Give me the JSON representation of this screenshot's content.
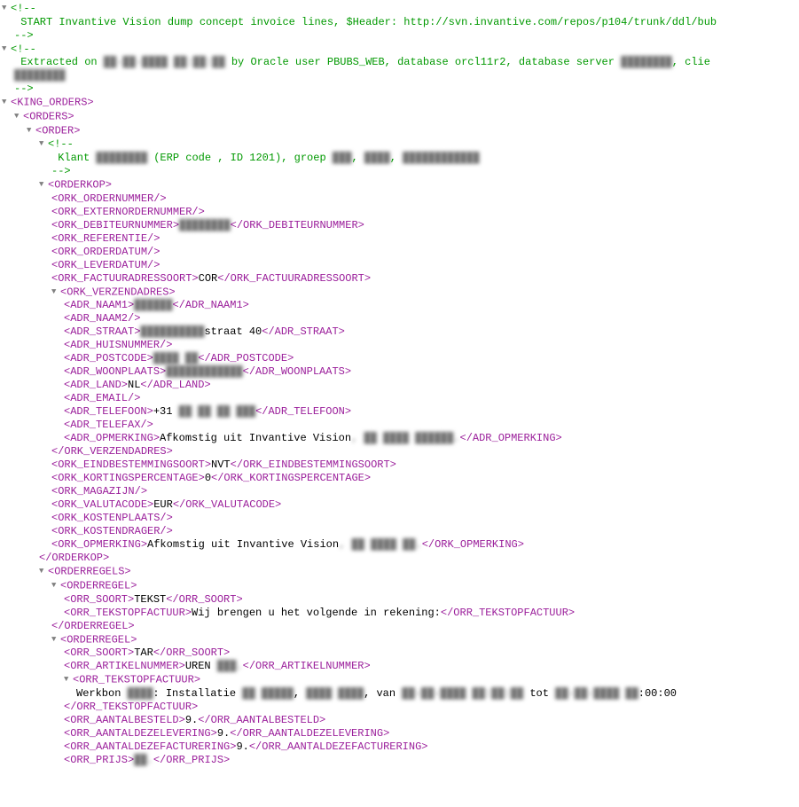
{
  "comment1_open": "<!--",
  "comment1_text": " START Invantive Vision dump concept invoice lines, $Header: http://svn.invantive.com/repos/p104/trunk/ddl/bub",
  "comment1_close": "-->",
  "comment2_open": "<!--",
  "comment2_a": " Extracted on ",
  "comment2_date_blur": "██-██-████ ██:██:██",
  "comment2_b": " by Oracle user PBUBS_WEB, database orcl11r2, database server ",
  "comment2_server_blur": "████████",
  "comment2_c": ", clie",
  "comment2_l2_blur": "████████",
  "comment2_close": "-->",
  "king_orders_open": "<KING_ORDERS>",
  "orders_open": "<ORDERS>",
  "order_open": "<ORDER>",
  "klant_open": "<!--",
  "klant_a": " Klant ",
  "klant_blur1": "████████",
  "klant_b": " (ERP code , ID 1201), groep ",
  "klant_blur2": "███",
  "klant_c": ", ",
  "klant_blur3": "████",
  "klant_d": ", ",
  "klant_blur4": "████████████",
  "klant_close": "-->",
  "orderkop_open": "<ORDERKOP>",
  "ork_ordernummer": "<ORK_ORDERNUMMER/>",
  "ork_externordernummer": "<ORK_EXTERNORDERNUMMER/>",
  "ork_debiteurnummer_open": "<ORK_DEBITEURNUMMER>",
  "ork_debiteurnummer_val_blur": "████████",
  "ork_debiteurnummer_close": "</ORK_DEBITEURNUMMER>",
  "ork_referentie": "<ORK_REFERENTIE/>",
  "ork_orderdatum": "<ORK_ORDERDATUM/>",
  "ork_leverdatum": "<ORK_LEVERDATUM/>",
  "ork_factuuradressoort_open": "<ORK_FACTUURADRESSOORT>",
  "ork_factuuradressoort_val": "COR",
  "ork_factuuradressoort_close": "</ORK_FACTUURADRESSOORT>",
  "ork_verzendadres_open": "<ORK_VERZENDADRES>",
  "adr_naam1_open": "<ADR_NAAM1>",
  "adr_naam1_val_blur": "██████",
  "adr_naam1_close": "</ADR_NAAM1>",
  "adr_naam2": "<ADR_NAAM2/>",
  "adr_straat_open": "<ADR_STRAAT>",
  "adr_straat_pre_blur": "██████████",
  "adr_straat_val": "straat 40",
  "adr_straat_close": "</ADR_STRAAT>",
  "adr_huisnummer": "<ADR_HUISNUMMER/>",
  "adr_postcode_open": "<ADR_POSTCODE>",
  "adr_postcode_val_blur": "████ ██",
  "adr_postcode_close": "</ADR_POSTCODE>",
  "adr_woonplaats_open": "<ADR_WOONPLAATS>",
  "adr_woonplaats_val_blur": "████████████",
  "adr_woonplaats_close": "</ADR_WOONPLAATS>",
  "adr_land_open": "<ADR_LAND>",
  "adr_land_val": "NL",
  "adr_land_close": "</ADR_LAND>",
  "adr_email": "<ADR_EMAIL/>",
  "adr_telefoon_open": "<ADR_TELEFOON>",
  "adr_telefoon_val": "+31 ",
  "adr_telefoon_blur": "██ ██ ██ ███",
  "adr_telefoon_close": "</ADR_TELEFOON>",
  "adr_telefax": "<ADR_TELEFAX/>",
  "adr_opmerking_open": "<ADR_OPMERKING>",
  "adr_opmerking_val": "Afkomstig uit Invantive Vision",
  "adr_opmerking_blur": ", ██ ████ ██████.",
  "adr_opmerking_close": "</ADR_OPMERKING>",
  "ork_verzendadres_close": "</ORK_VERZENDADRES>",
  "ork_eindbestemmingsoort_open": "<ORK_EINDBESTEMMINGSOORT>",
  "ork_eindbestemmingsoort_val": "NVT",
  "ork_eindbestemmingsoort_close": "</ORK_EINDBESTEMMINGSOORT>",
  "ork_kortingspercentage_open": "<ORK_KORTINGSPERCENTAGE>",
  "ork_kortingspercentage_val": "0",
  "ork_kortingspercentage_close": "</ORK_KORTINGSPERCENTAGE>",
  "ork_magazijn": "<ORK_MAGAZIJN/>",
  "ork_valutacode_open": "<ORK_VALUTACODE>",
  "ork_valutacode_val": "EUR",
  "ork_valutacode_close": "</ORK_VALUTACODE>",
  "ork_kostenplaats": "<ORK_KOSTENPLAATS/>",
  "ork_kostendrager": "<ORK_KOSTENDRAGER/>",
  "ork_opmerking_open": "<ORK_OPMERKING>",
  "ork_opmerking_val": "Afkomstig uit Invantive Vision",
  "ork_opmerking_blur": ", ██ ████ ██.",
  "ork_opmerking_close": "</ORK_OPMERKING>",
  "orderkop_close": "</ORDERKOP>",
  "orderregels_open": "<ORDERREGELS>",
  "orderregel_open": "<ORDERREGEL>",
  "orr_soort_open": "<ORR_SOORT>",
  "orr_soort_val1": "TEKST",
  "orr_soort_close": "</ORR_SOORT>",
  "orr_tekstopfactuur_open": "<ORR_TEKSTOPFACTUUR>",
  "orr_tekstopfactuur_val1": "Wij brengen u het volgende in rekening:",
  "orr_tekstopfactuur_close": "</ORR_TEKSTOPFACTUUR>",
  "orderregel_close": "</ORDERREGEL>",
  "orr_soort_val2": "TAR",
  "orr_artikelnummer_open": "<ORR_ARTIKELNUMMER>",
  "orr_artikelnummer_val": "UREN ",
  "orr_artikelnummer_blur": "███.",
  "orr_artikelnummer_close": "</ORR_ARTIKELNUMMER>",
  "werkbon_a": "Werkbon ",
  "werkbon_blur1": "████",
  "werkbon_b": ": Installatie ",
  "werkbon_blur2": "██ █████",
  "werkbon_c": ", ",
  "werkbon_blur3": "████ ████",
  "werkbon_d": ", van ",
  "werkbon_blur4": "██-██-████ ██:██:██",
  "werkbon_e": " tot ",
  "werkbon_blur5": "██-██-████ ██",
  "werkbon_f": ":00:00",
  "orr_aantalbesteld_open": "<ORR_AANTALBESTELD>",
  "orr_aantalbesteld_val": "9.",
  "orr_aantalbesteld_close": "</ORR_AANTALBESTELD>",
  "orr_aantaldezelev_open": "<ORR_AANTALDEZELEVERING>",
  "orr_aantaldezelev_val": "9.",
  "orr_aantaldezelev_close": "</ORR_AANTALDEZELEVERING>",
  "orr_aantaldezefact_open": "<ORR_AANTALDEZEFACTURERING>",
  "orr_aantaldezefact_val": "9.",
  "orr_aantaldezefact_close": "</ORR_AANTALDEZEFACTURERING>",
  "orr_prijs_open": "<ORR_PRIJS>",
  "orr_prijs_val_blur": "██.",
  "orr_prijs_close": "</ORR_PRIJS>",
  "arrow": "▼"
}
